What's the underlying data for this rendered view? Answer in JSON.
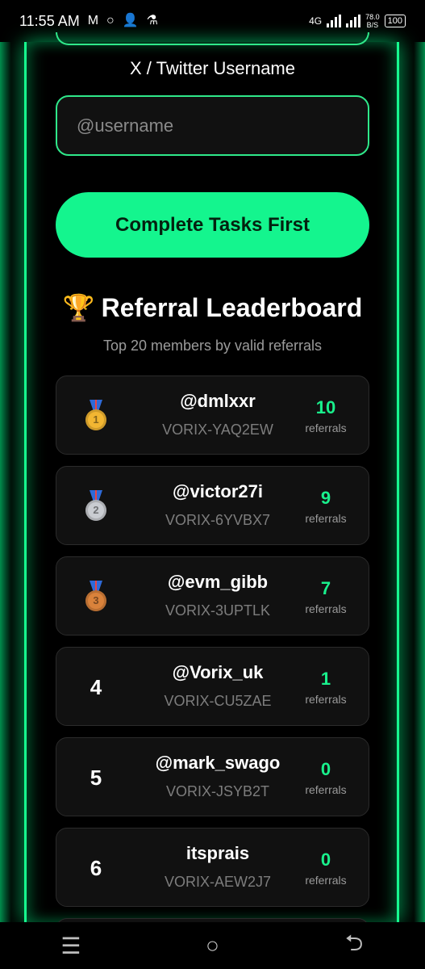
{
  "status_bar": {
    "time": "11:55 AM",
    "network": "4G",
    "net_speed_value": "78.0",
    "net_speed_unit": "B/S",
    "battery": "100"
  },
  "form": {
    "field_label": "X / Twitter Username",
    "placeholder": "@username",
    "value": "",
    "button_label": "Complete Tasks First"
  },
  "leaderboard": {
    "title": "Referral Leaderboard",
    "trophy_icon": "🏆",
    "subtitle": "Top 20 members by valid referrals",
    "referrals_label": "referrals",
    "entries": [
      {
        "rank": "1",
        "medal": "gold",
        "handle": "@dmlxxr",
        "code": "VORIX-YAQ2EW",
        "count": "10",
        "label": "referrals"
      },
      {
        "rank": "2",
        "medal": "silver",
        "handle": "@victor27i",
        "code": "VORIX-6YVBX7",
        "count": "9",
        "label": "referrals"
      },
      {
        "rank": "3",
        "medal": "bronze",
        "handle": "@evm_gibb",
        "code": "VORIX-3UPTLK",
        "count": "7",
        "label": "referrals"
      },
      {
        "rank": "4",
        "medal": "",
        "handle": "@Vorix_uk",
        "code": "VORIX-CU5ZAE",
        "count": "1",
        "label": "referrals"
      },
      {
        "rank": "5",
        "medal": "",
        "handle": "@mark_swago",
        "code": "VORIX-JSYB2T",
        "count": "0",
        "label": "referrals"
      },
      {
        "rank": "6",
        "medal": "",
        "handle": "itsprais",
        "code": "VORIX-AEW2J7",
        "count": "0",
        "label": "referrals"
      }
    ]
  },
  "nav": {
    "recents_icon": "☰",
    "home_icon": "○",
    "back_icon": "⮌"
  },
  "colors": {
    "accent": "#14f58e",
    "gold": "#f2b632",
    "silver": "#c9ccd1",
    "bronze": "#d9823b"
  }
}
